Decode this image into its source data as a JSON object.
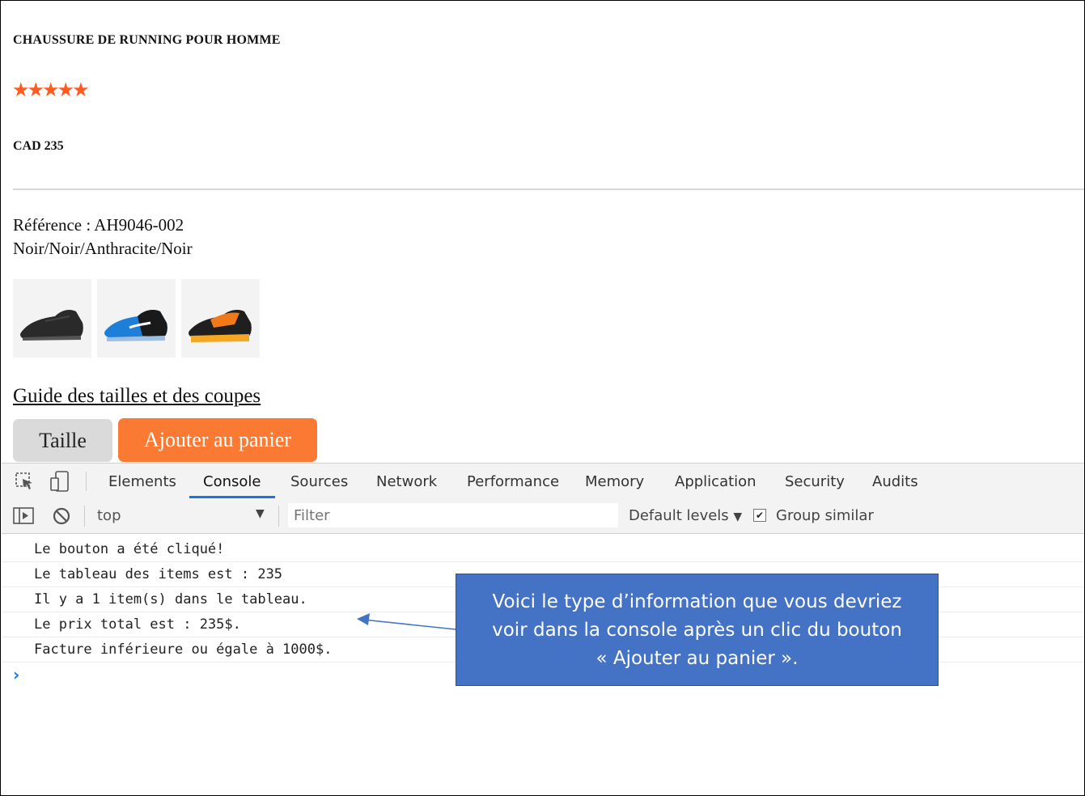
{
  "product": {
    "title": "CHAUSSURE DE RUNNING POUR HOMME",
    "rating_stars": "★★★★★",
    "rating": 5,
    "price": "CAD 235",
    "reference": "Référence : AH9046-002",
    "colors": "Noir/Noir/Anthracite/Noir",
    "thumbnails": [
      "black-shoe-image",
      "blue-shoe-image",
      "orange-shoe-image"
    ],
    "size_guide_link": "Guide des tailles et des coupes",
    "size_button": "Taille",
    "add_to_cart_button": "Ajouter au panier",
    "accent_color": "#fb7a33"
  },
  "devtools": {
    "tabs": [
      "Elements",
      "Console",
      "Sources",
      "Network",
      "Performance",
      "Memory",
      "Application",
      "Security",
      "Audits"
    ],
    "active_tab": "Console",
    "context": "top",
    "filter_placeholder": "Filter",
    "levels": "Default levels",
    "group_similar": "Group similar",
    "group_similar_checked": true,
    "console_lines": [
      "Le bouton a été cliqué!",
      "Le tableau des items est : 235",
      "Il y a 1 item(s) dans le tableau.",
      "Le prix total est : 235$.",
      "Facture inférieure ou égale à 1000$."
    ],
    "prompt": "›"
  },
  "callout": {
    "lines": [
      "Voici le type d’information que vous devriez",
      "voir dans la console après un clic du bouton",
      "« Ajouter au panier »."
    ],
    "color": "#4472c4"
  }
}
